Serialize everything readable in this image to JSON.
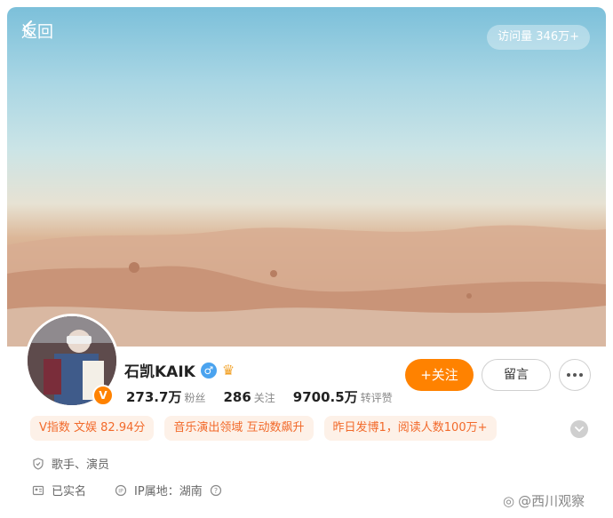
{
  "header": {
    "back_label": "返回",
    "visits": "访问量 346万+"
  },
  "profile": {
    "name": "石凯KAIK",
    "gender_icon": "♂",
    "verified_badge": "V",
    "stats": [
      {
        "value": "273.7万",
        "label": "粉丝"
      },
      {
        "value": "286",
        "label": "关注"
      },
      {
        "value": "9700.5万",
        "label": "转评赞"
      }
    ]
  },
  "actions": {
    "follow_label": "+关注",
    "message_label": "留言"
  },
  "tags": [
    "V指数 文娱 82.94分",
    "音乐演出领域 互动数飙升",
    "昨日发博1，阅读人数100万+"
  ],
  "info": {
    "occupation": "歌手、演员",
    "real_name": "已实名",
    "ip_location": "IP属地：湖南"
  },
  "watermark": "@西川观察",
  "colors": {
    "accent": "#ff8200",
    "tag_bg": "#fdf1e8",
    "tag_text": "#f26a2b"
  }
}
